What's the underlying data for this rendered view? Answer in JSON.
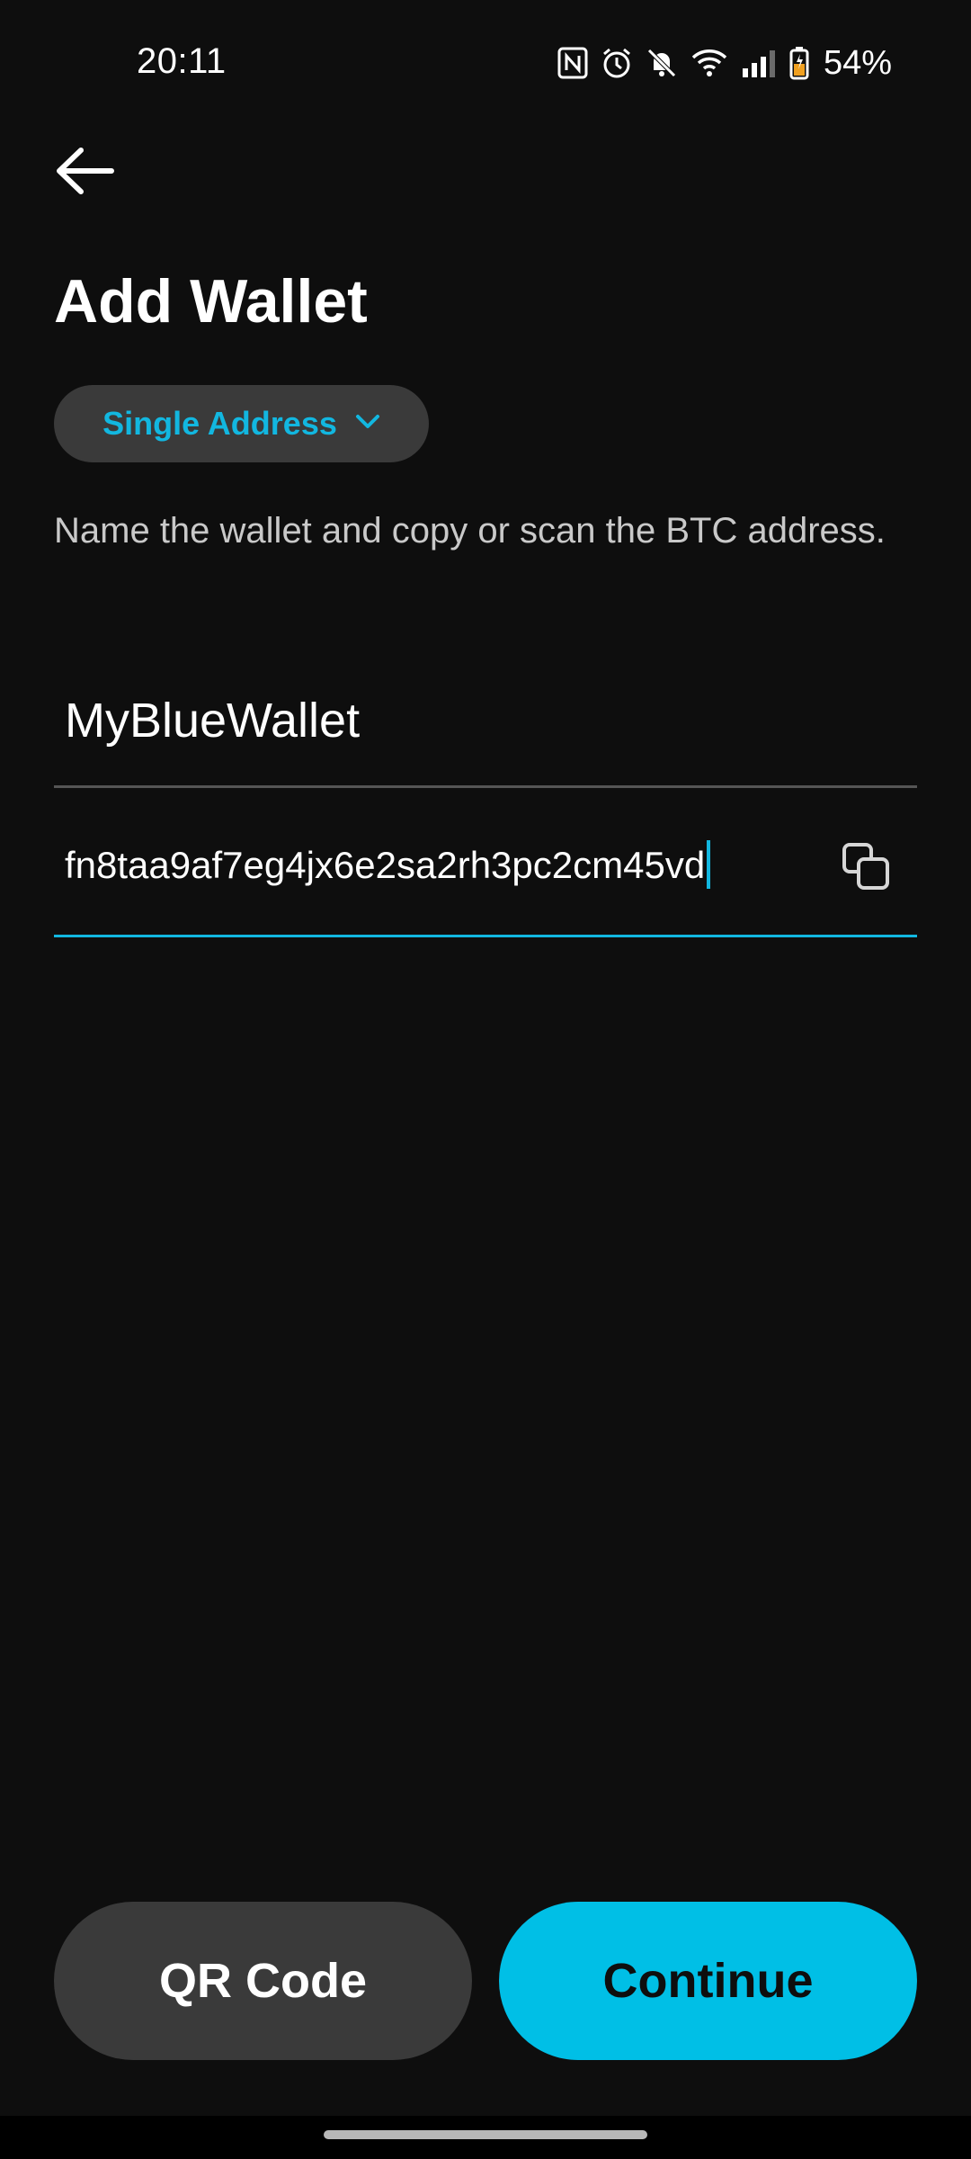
{
  "status_bar": {
    "time": "20:11",
    "battery": "54%",
    "icons": [
      "nfc-icon",
      "alarm-icon",
      "mute-icon",
      "wifi-icon",
      "signal-icon",
      "battery-icon"
    ]
  },
  "header": {
    "back_icon": "arrow-left-icon",
    "title": "Add Wallet"
  },
  "wallet_type": {
    "selected": "Single Address",
    "icon": "chevron-down-icon"
  },
  "instructions": "Name the wallet and copy or scan the BTC address.",
  "form": {
    "name_value": "MyBlueWallet",
    "address_value": "fn8taa9af7eg4jx6e2sa2rh3pc2cm45vd",
    "paste_icon": "copy-icon"
  },
  "actions": {
    "qr_label": "QR Code",
    "continue_label": "Continue"
  },
  "colors": {
    "accent": "#00bfe6",
    "background": "#0e0e0e",
    "pill": "#3a3a3a"
  }
}
